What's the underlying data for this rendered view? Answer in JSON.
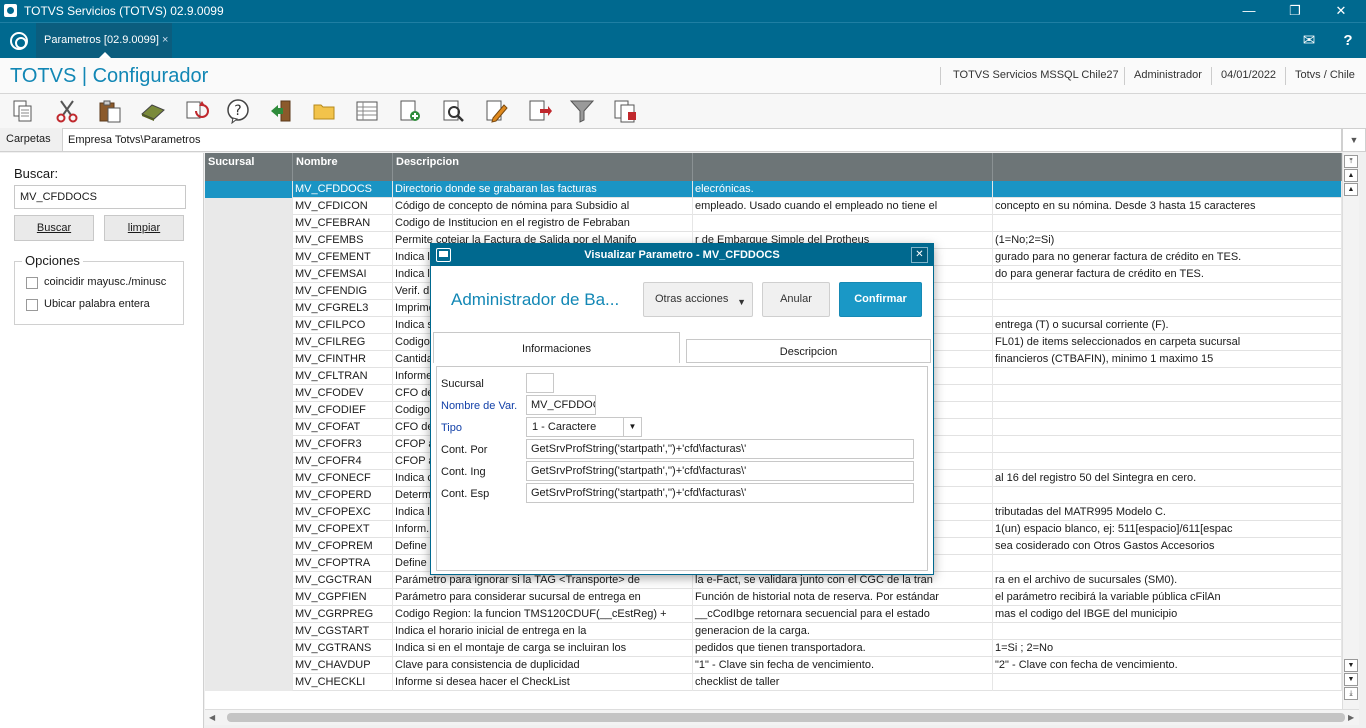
{
  "window": {
    "title": "TOTVS Servicios (TOTVS) 02.9.0099",
    "minimize": "—",
    "restore": "❐",
    "close": "✕"
  },
  "tabbar": {
    "tab_label": "Parametros [02.9.0099]",
    "tab_close": "×",
    "mail_icon": "✉",
    "help_icon": "?"
  },
  "header": {
    "app_title": "TOTVS | Configurador",
    "server": "TOTVS Servicios MSSQL Chile27",
    "user": "Administrador",
    "date": "04/01/2022",
    "company": "Totvs / Chile"
  },
  "toolbar": {
    "icons": [
      "copy-icon",
      "cut-icon",
      "paste-icon",
      "eraser-icon",
      "refresh-icon",
      "help-icon",
      "exit-icon",
      "folder-icon",
      "grid-icon",
      "add-doc-icon",
      "search-doc-icon",
      "edit-icon",
      "delete-doc-icon",
      "filter-icon",
      "docs-icon"
    ]
  },
  "folder": {
    "label": "Carpetas",
    "path": "Empresa Totvs\\Parametros",
    "dropdown": "▼"
  },
  "search": {
    "label": "Buscar:",
    "value": "MV_CFDDOCS",
    "search_button": "Buscar",
    "clear_button": "limpiar",
    "options_title": "Opciones",
    "opt1": "coincidir mayusc./minusc",
    "opt2": "Ubicar palabra entera"
  },
  "grid": {
    "headers": [
      "Sucursal",
      "Nombre",
      "Descripcion",
      "",
      ""
    ],
    "rows": [
      [
        "",
        "MV_CFDDOCS",
        "Directorio donde se grabaran las facturas",
        "elecrónicas.",
        ""
      ],
      [
        "",
        "MV_CFDICON",
        "Código de concepto de nómina para Subsidio al",
        "empleado. Usado cuando el empleado no tiene el",
        "concepto en su nómina. Desde 3 hasta 15 caracteres"
      ],
      [
        "",
        "MV_CFEBRAN",
        "Codigo de Institucion en el registro de Febraban",
        "",
        ""
      ],
      [
        "",
        "MV_CFEMBS",
        "Permite cotejar la Factura de Salida por el Manifo",
        "r de Embarque Simple del Protheus",
        "(1=No;2=Si)"
      ],
      [
        "",
        "MV_CFEMENT",
        "Indica la",
        "",
        "gurado para no generar factura de crédito en TES."
      ],
      [
        "",
        "MV_CFEMSAI",
        "Indica la",
        "",
        "do para generar factura de crédito en TES."
      ],
      [
        "",
        "MV_CFENDIG",
        "Verif. d",
        "",
        ""
      ],
      [
        "",
        "MV_CFGREL3",
        "Imprime",
        "",
        ""
      ],
      [
        "",
        "MV_CFILPCO",
        "Indica s",
        "",
        "entrega (T) o sucursal corriente (F)."
      ],
      [
        "",
        "MV_CFILREG",
        "Codigo",
        "",
        "FL01) de items seleccionados en carpeta sucursal"
      ],
      [
        "",
        "MV_CFINTHR",
        "Cantida",
        "",
        "financieros (CTBAFIN), minimo 1 maximo 15"
      ],
      [
        "",
        "MV_CFLTRAN",
        "Informe",
        "",
        ""
      ],
      [
        "",
        "MV_CFODEV",
        "CFO de",
        "",
        ""
      ],
      [
        "",
        "MV_CFODIEF",
        "Codigos",
        "",
        ""
      ],
      [
        "",
        "MV_CFOFAT",
        "CFO de",
        "",
        ""
      ],
      [
        "",
        "MV_CFOFR3",
        "CFOP a",
        "",
        ""
      ],
      [
        "",
        "MV_CFOFR4",
        "CFOP a",
        "",
        ""
      ],
      [
        "",
        "MV_CFONECF",
        "Indica c",
        "",
        "al 16 del registro 50 del Sintegra en cero."
      ],
      [
        "",
        "MV_CFOPERD",
        "Determ",
        "",
        ""
      ],
      [
        "",
        "MV_CFOPEXC",
        "Indica la",
        "",
        "tributadas del MATR995 Modelo C."
      ],
      [
        "",
        "MV_CFOPEXT",
        "Inform.",
        "",
        "1(un) espacio blanco, ej: 511[espacio]/611[espac"
      ],
      [
        "",
        "MV_CFOPREM",
        "Define c",
        "",
        "sea cosiderado con Otros Gastos Accesorios"
      ],
      [
        "",
        "MV_CFOPTRA",
        "Define",
        "",
        ""
      ],
      [
        "",
        "MV_CGCTRAN",
        "Parámetro para ignorar si la TAG <Transporte> de",
        "la e-Fact, se validara junto con el CGC de la tran",
        "ra en el archivo de sucursales (SM0)."
      ],
      [
        "",
        "MV_CGPFIEN",
        "Parámetro para considerar sucursal de entrega en",
        "Función de historial nota de reserva. Por estándar",
        "el parámetro recibirá la variable pública cFilAn"
      ],
      [
        "",
        "MV_CGRPREG",
        "Codigo Region: la funcion TMS120CDUF(__cEstReg) +",
        "__cCodIbge retornara secuencial para el estado",
        "mas el codigo del IBGE del municipio"
      ],
      [
        "",
        "MV_CGSTART",
        "Indica el horario inicial de entrega en la",
        "generacion de la carga.",
        ""
      ],
      [
        "",
        "MV_CGTRANS",
        "Indica si en el montaje de carga se incluiran los",
        "pedidos que tienen transportadora.",
        "1=Si ; 2=No"
      ],
      [
        "",
        "MV_CHAVDUP",
        "Clave para consistencia de duplicidad",
        "\"1\" - Clave sin fecha de vencimiento.",
        "\"2\" - Clave con fecha de vencimiento."
      ],
      [
        "",
        "MV_CHECKLI",
        "Informe si desea hacer el CheckList",
        "checklist de taller",
        ""
      ]
    ]
  },
  "modal": {
    "title": "Visualizar Parametro - MV_CFDDOCS",
    "close": "✕",
    "admin_label": "Administrador de Ba...",
    "otras_acciones": "Otras acciones",
    "anular": "Anular",
    "confirmar": "Confirmar",
    "tab_info": "Informaciones",
    "tab_desc": "Descripcion",
    "fields": {
      "sucursal_label": "Sucursal",
      "sucursal_value": "",
      "nombre_label": "Nombre de Var.",
      "nombre_value": "MV_CFDDOC",
      "tipo_label": "Tipo",
      "tipo_value": "1 - Caractere",
      "cont_por_label": "Cont. Por",
      "cont_por_value": "GetSrvProfString('startpath','')+'cfd\\facturas\\'",
      "cont_ing_label": "Cont. Ing",
      "cont_ing_value": "GetSrvProfString('startpath','')+'cfd\\facturas\\'",
      "cont_esp_label": "Cont. Esp",
      "cont_esp_value": "GetSrvProfString('startpath','')+'cfd\\facturas\\'"
    }
  },
  "colors": {
    "primary": "#00698f",
    "accent": "#1a94c4",
    "grid_header": "#6d7577"
  }
}
